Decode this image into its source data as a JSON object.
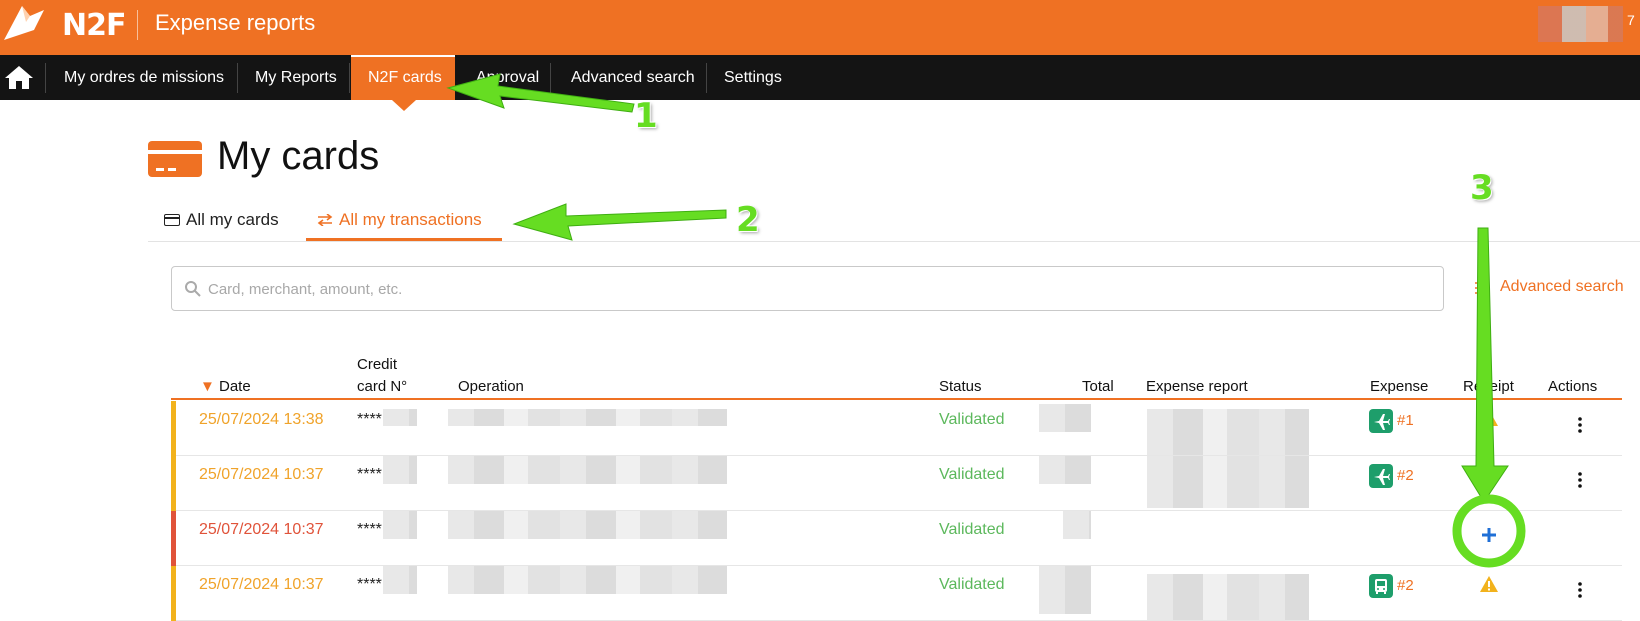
{
  "app": {
    "brand": "N2F",
    "title": "Expense reports",
    "avatar_badge": "7"
  },
  "nav": {
    "items": [
      {
        "label": "My ordres de missions"
      },
      {
        "label": "My Reports"
      },
      {
        "label": "N2F cards",
        "active": true
      },
      {
        "label": "Approval"
      },
      {
        "label": "Advanced search"
      },
      {
        "label": "Settings"
      }
    ]
  },
  "page": {
    "title": "My cards"
  },
  "tabs": [
    {
      "label": "All my cards"
    },
    {
      "label": "All my transactions",
      "active": true
    }
  ],
  "search": {
    "placeholder": "Card, merchant, amount, etc.",
    "advanced_label": "Advanced search"
  },
  "table": {
    "headers": {
      "date": "Date",
      "card_line1": "Credit",
      "card_line2": "card N°",
      "operation": "Operation",
      "status": "Status",
      "total": "Total",
      "expense_report": "Expense report",
      "expense": "Expense",
      "receipt": "Receipt",
      "actions": "Actions"
    },
    "rows": [
      {
        "date": "25/07/2024 13:38",
        "card": "****",
        "status": "Validated",
        "expense_icon": "plane-icon",
        "expense_ref": "#1",
        "receipt": "warning",
        "accent": "#f2b21c"
      },
      {
        "date": "25/07/2024 10:37",
        "card": "****",
        "status": "Validated",
        "expense_icon": "plane-icon",
        "expense_ref": "#2",
        "receipt": "none",
        "accent": "#f2b21c"
      },
      {
        "date": "25/07/2024 10:37",
        "card": "****",
        "status": "Validated",
        "expense_icon": "",
        "expense_ref": "",
        "receipt": "add",
        "accent": "#e0533a"
      },
      {
        "date": "25/07/2024 10:37",
        "card": "****",
        "status": "Validated",
        "expense_icon": "bus-icon",
        "expense_ref": "#2",
        "receipt": "warning",
        "accent": "#f2b21c"
      }
    ]
  },
  "annotations": [
    "1",
    "2",
    "3"
  ],
  "colors": {
    "brand": "#ef7123",
    "nav": "#141414",
    "status_validated": "#5cb85c",
    "date_pending": "#f0a32a",
    "date_alert": "#e0533a",
    "annotation": "#66dd22"
  }
}
